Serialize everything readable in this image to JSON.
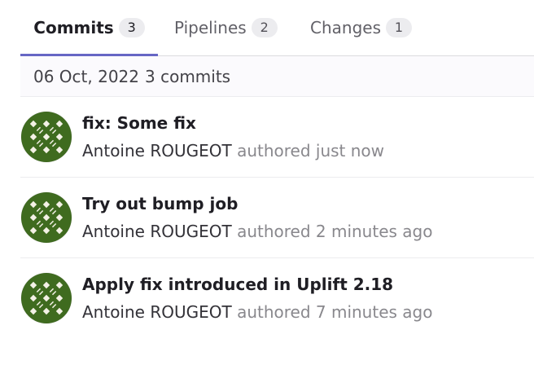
{
  "tabs": [
    {
      "label": "Commits",
      "count": "3"
    },
    {
      "label": "Pipelines",
      "count": "2"
    },
    {
      "label": "Changes",
      "count": "1"
    }
  ],
  "date_group": {
    "date": "06 Oct, 2022",
    "count": "3 commits"
  },
  "commits": [
    {
      "title": "fix: Some fix",
      "author": "Antoine ROUGEOT",
      "when": "authored just now",
      "avatar_icon": "identicon-avatar"
    },
    {
      "title": "Try out bump job",
      "author": "Antoine ROUGEOT",
      "when": "authored 2 minutes ago",
      "avatar_icon": "identicon-avatar"
    },
    {
      "title": "Apply fix introduced in Uplift 2.18",
      "author": "Antoine ROUGEOT",
      "when": "authored 7 minutes ago",
      "avatar_icon": "identicon-avatar"
    }
  ],
  "colors": {
    "active_tab_underline": "#6666c4",
    "avatar_green": "#3f6b1f",
    "avatar_light": "#f4f1e6"
  }
}
